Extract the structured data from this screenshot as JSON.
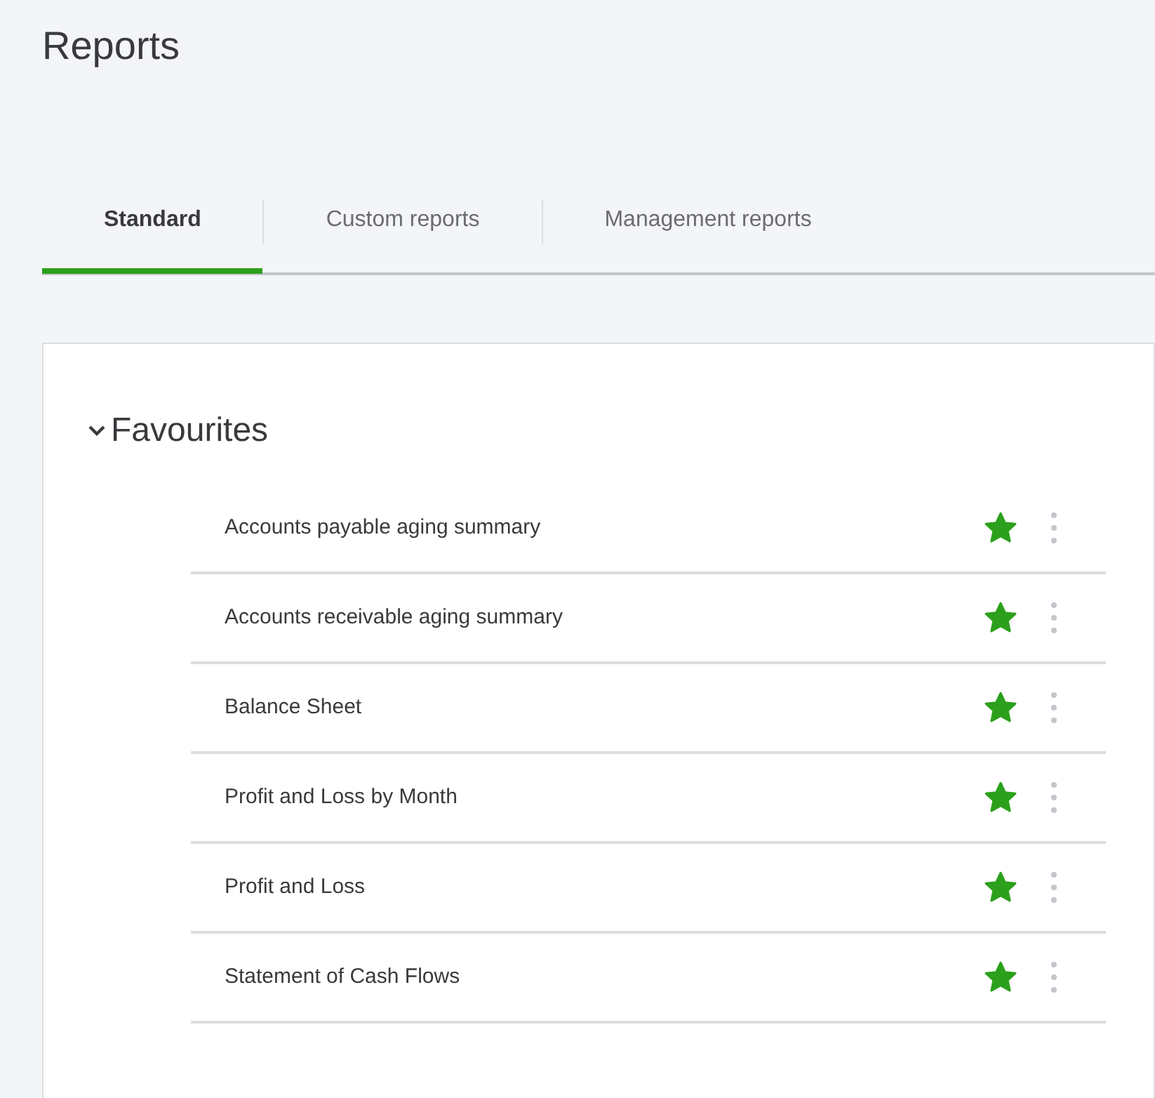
{
  "page": {
    "title": "Reports"
  },
  "tabs": [
    {
      "label": "Standard",
      "selected": true
    },
    {
      "label": "Custom reports",
      "selected": false
    },
    {
      "label": "Management reports",
      "selected": false
    }
  ],
  "section": {
    "title": "Favourites",
    "expanded": true,
    "reports": [
      {
        "name": "Accounts payable aging summary",
        "favourite": true
      },
      {
        "name": "Accounts receivable aging summary",
        "favourite": true
      },
      {
        "name": "Balance Sheet",
        "favourite": true
      },
      {
        "name": "Profit and Loss by Month",
        "favourite": true
      },
      {
        "name": "Profit and Loss",
        "favourite": true
      },
      {
        "name": "Statement of Cash Flows",
        "favourite": true
      }
    ]
  }
}
